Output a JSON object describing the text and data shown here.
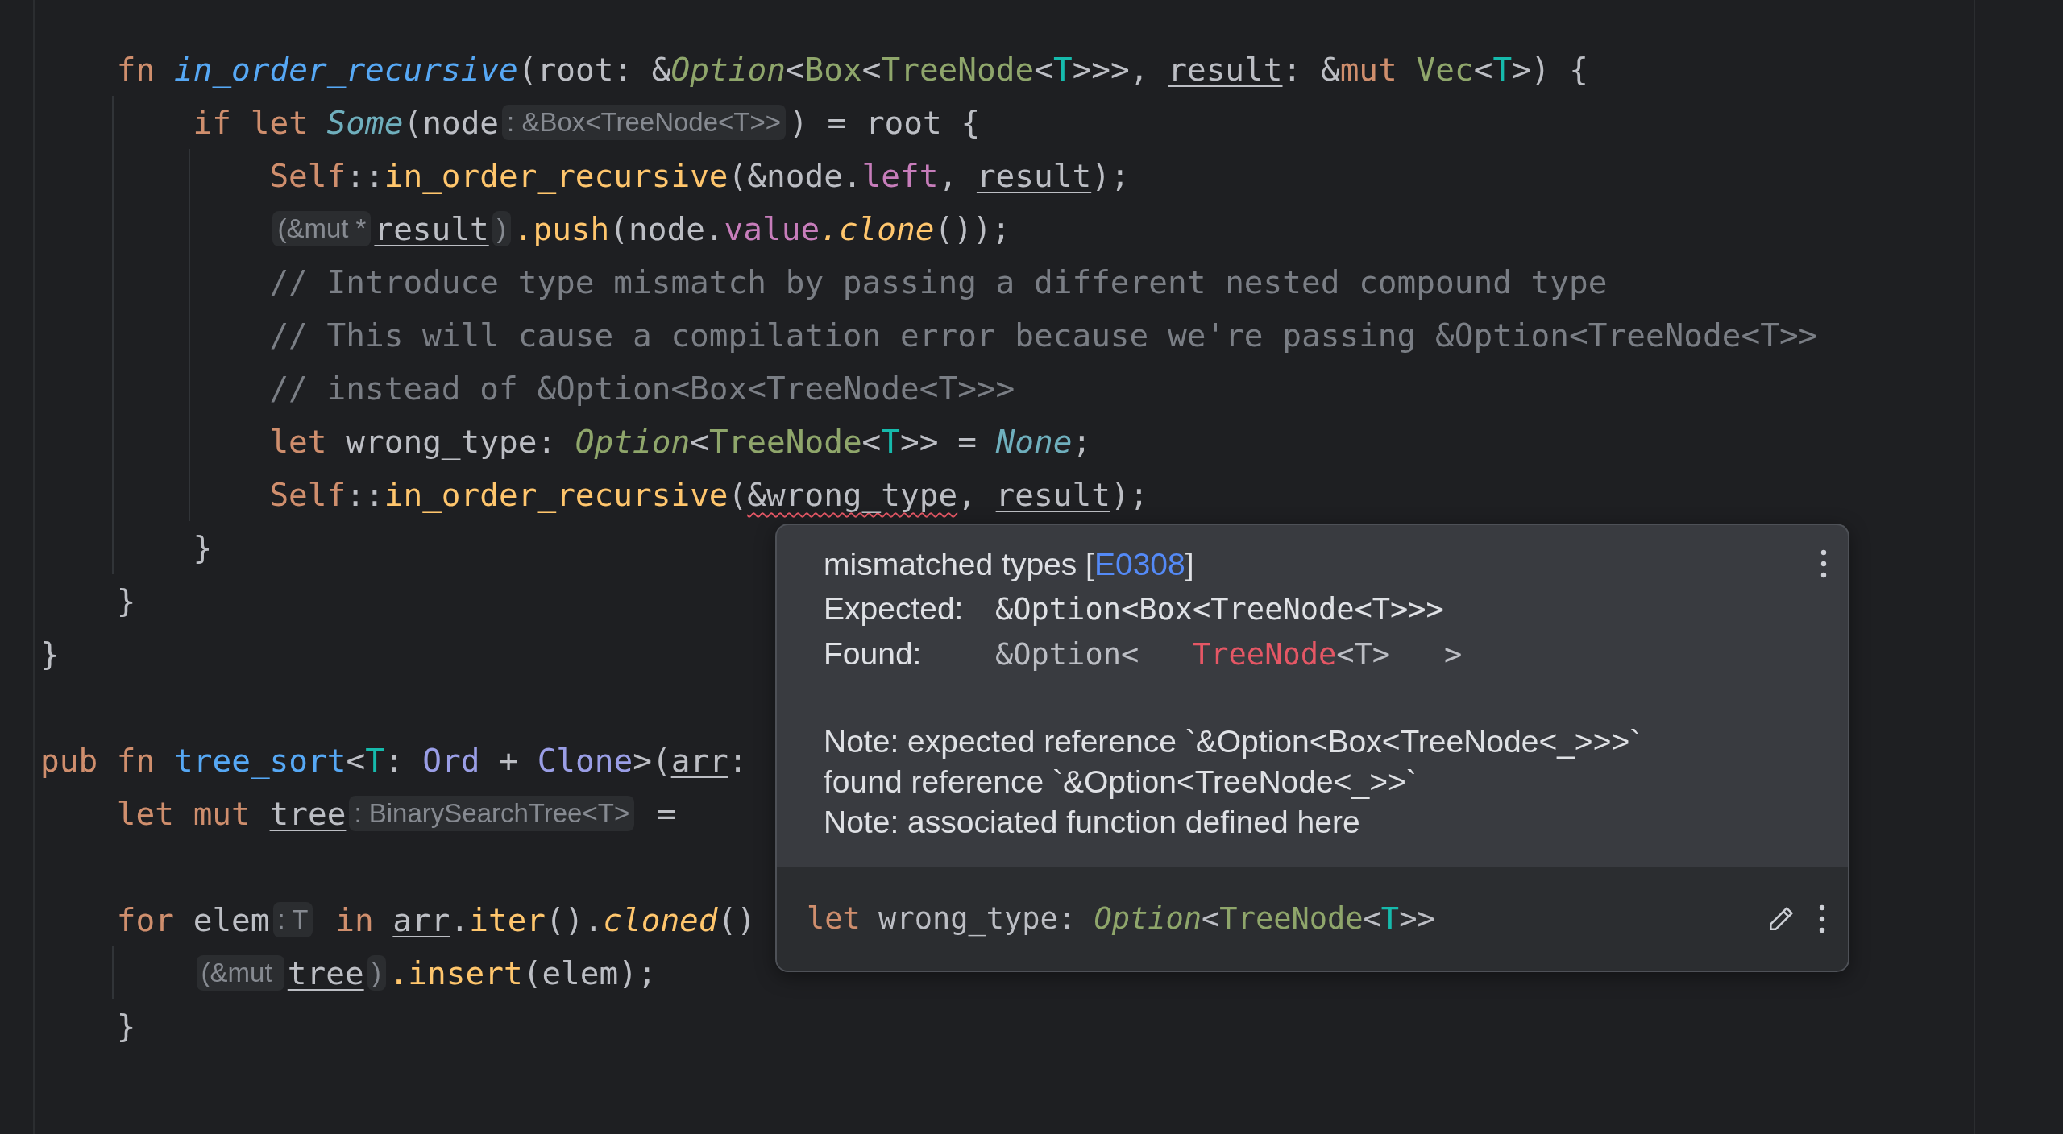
{
  "editor": {
    "lines": [
      {
        "kind": "code",
        "tokens": [
          {
            "text": "    fn ",
            "kind": "kw"
          },
          {
            "text": "in_order_recursive",
            "kind": "fn_decl_italic"
          },
          {
            "text": "(root: &",
            "kind": "plain"
          },
          {
            "text": "Option",
            "kind": "type_italic"
          },
          {
            "text": "<",
            "kind": "plain"
          },
          {
            "text": "Box",
            "kind": "type"
          },
          {
            "text": "<",
            "kind": "plain"
          },
          {
            "text": "TreeNode",
            "kind": "type"
          },
          {
            "text": "<",
            "kind": "plain"
          },
          {
            "text": "T",
            "kind": "generic"
          },
          {
            "text": ">>>, ",
            "kind": "plain"
          },
          {
            "text": "result",
            "kind": "underlined"
          },
          {
            "text": ": &",
            "kind": "plain"
          },
          {
            "text": "mut ",
            "kind": "kw"
          },
          {
            "text": "Vec",
            "kind": "type"
          },
          {
            "text": "<",
            "kind": "plain"
          },
          {
            "text": "T",
            "kind": "generic"
          },
          {
            "text": ">) {",
            "kind": "plain"
          }
        ]
      },
      {
        "kind": "code",
        "tokens": [
          {
            "text": "        if let ",
            "kind": "kw"
          },
          {
            "text": "Some",
            "kind": "variant_italic"
          },
          {
            "text": "(node",
            "kind": "plain"
          },
          {
            "text": ": &Box<TreeNode<T>>",
            "kind": "hint"
          },
          {
            "text": ") = root {",
            "kind": "plain"
          }
        ]
      },
      {
        "kind": "code",
        "tokens": [
          {
            "text": "            Self",
            "kind": "kw"
          },
          {
            "text": "::",
            "kind": "plain"
          },
          {
            "text": "in_order_recursive",
            "kind": "method"
          },
          {
            "text": "(&node.",
            "kind": "plain"
          },
          {
            "text": "left",
            "kind": "field"
          },
          {
            "text": ", ",
            "kind": "plain"
          },
          {
            "text": "result",
            "kind": "underlined"
          },
          {
            "text": ");",
            "kind": "plain"
          }
        ]
      },
      {
        "kind": "code",
        "tokens": [
          {
            "text": "            (&mut *",
            "kind": "hint"
          },
          {
            "text": "result",
            "kind": "underlined"
          },
          {
            "text": ")",
            "kind": "hint"
          },
          {
            "text": ".push",
            "kind": "method"
          },
          {
            "text": "(node.",
            "kind": "plain"
          },
          {
            "text": "value",
            "kind": "field"
          },
          {
            "text": ".clone",
            "kind": "method_italic"
          },
          {
            "text": "());",
            "kind": "plain"
          }
        ]
      },
      {
        "kind": "code",
        "tokens": [
          {
            "text": "            // Introduce type mismatch by passing a different nested compound type",
            "kind": "comment"
          }
        ]
      },
      {
        "kind": "code",
        "tokens": [
          {
            "text": "            // This will cause a compilation error because we're passing &Option<TreeNode<T>>",
            "kind": "comment"
          }
        ]
      },
      {
        "kind": "code",
        "tokens": [
          {
            "text": "            // instead of &Option<Box<TreeNode<T>>>",
            "kind": "comment"
          }
        ]
      },
      {
        "kind": "code",
        "tokens": [
          {
            "text": "            let ",
            "kind": "kw"
          },
          {
            "text": "wrong_type: ",
            "kind": "plain"
          },
          {
            "text": "Option",
            "kind": "type_italic"
          },
          {
            "text": "<",
            "kind": "plain"
          },
          {
            "text": "TreeNode",
            "kind": "type"
          },
          {
            "text": "<",
            "kind": "plain"
          },
          {
            "text": "T",
            "kind": "generic"
          },
          {
            "text": ">> = ",
            "kind": "plain"
          },
          {
            "text": "None",
            "kind": "variant_italic"
          },
          {
            "text": ";",
            "kind": "plain"
          }
        ]
      },
      {
        "kind": "code",
        "tokens": [
          {
            "text": "            Self",
            "kind": "kw"
          },
          {
            "text": "::",
            "kind": "plain"
          },
          {
            "text": "in_order_recursive",
            "kind": "method"
          },
          {
            "text": "(",
            "kind": "plain"
          },
          {
            "text": "&wrong_type",
            "kind": "error"
          },
          {
            "text": ", ",
            "kind": "plain"
          },
          {
            "text": "result",
            "kind": "underlined"
          },
          {
            "text": ");",
            "kind": "plain"
          }
        ]
      },
      {
        "kind": "code",
        "tokens": [
          {
            "text": "        }",
            "kind": "plain"
          }
        ]
      },
      {
        "kind": "code",
        "tokens": [
          {
            "text": "    }",
            "kind": "plain"
          }
        ]
      },
      {
        "kind": "code",
        "tokens": [
          {
            "text": "}",
            "kind": "plain"
          }
        ]
      },
      {
        "kind": "blank"
      },
      {
        "kind": "code",
        "tokens": [
          {
            "text": "pub fn ",
            "kind": "kw"
          },
          {
            "text": "tree_sort",
            "kind": "fn_decl"
          },
          {
            "text": "<",
            "kind": "plain"
          },
          {
            "text": "T",
            "kind": "generic"
          },
          {
            "text": ": ",
            "kind": "plain"
          },
          {
            "text": "Ord",
            "kind": "trait"
          },
          {
            "text": " + ",
            "kind": "plain"
          },
          {
            "text": "Clone",
            "kind": "trait"
          },
          {
            "text": ">(",
            "kind": "plain"
          },
          {
            "text": "arr",
            "kind": "underlined"
          },
          {
            "text": ":",
            "kind": "plain"
          }
        ]
      },
      {
        "kind": "code",
        "tokens": [
          {
            "text": "    let mut ",
            "kind": "kw"
          },
          {
            "text": "tree",
            "kind": "underlined"
          },
          {
            "text": ": BinarySearchTree<T>",
            "kind": "hint"
          },
          {
            "text": " =",
            "kind": "plain"
          }
        ]
      },
      {
        "kind": "blank"
      },
      {
        "kind": "code",
        "tokens": [
          {
            "text": "    for ",
            "kind": "kw"
          },
          {
            "text": "elem",
            "kind": "plain"
          },
          {
            "text": ": T",
            "kind": "hint"
          },
          {
            "text": " in ",
            "kind": "kw"
          },
          {
            "text": "arr",
            "kind": "underlined"
          },
          {
            "text": ".",
            "kind": "plain"
          },
          {
            "text": "iter",
            "kind": "method"
          },
          {
            "text": "().",
            "kind": "plain"
          },
          {
            "text": "cloned",
            "kind": "method_italic"
          },
          {
            "text": "()",
            "kind": "plain"
          }
        ]
      },
      {
        "kind": "code",
        "tokens": [
          {
            "text": "        (&mut ",
            "kind": "hint"
          },
          {
            "text": "tree",
            "kind": "underlined"
          },
          {
            "text": ")",
            "kind": "hint"
          },
          {
            "text": ".insert",
            "kind": "method"
          },
          {
            "text": "(elem);",
            "kind": "plain"
          }
        ]
      },
      {
        "kind": "code",
        "tokens": [
          {
            "text": "    }",
            "kind": "plain"
          }
        ]
      }
    ]
  },
  "error_popup": {
    "title": "mismatched types [",
    "error_code": "E0308",
    "title_close": "]",
    "expected": {
      "label": "Expected:",
      "value": "&Option<Box<TreeNode<T>>>"
    },
    "found": {
      "label": "Found:",
      "parts": [
        {
          "text": "&Option<   ",
          "kind": "plain"
        },
        {
          "text": "TreeNode",
          "kind": "mismatch"
        },
        {
          "text": "<T>   >",
          "kind": "plain"
        }
      ]
    },
    "notes": [
      "Note: expected reference `&Option<Box<TreeNode<_>>>`",
      "found reference `&Option<TreeNode<_>>`",
      "Note: associated function defined here"
    ],
    "declaration": [
      {
        "text": "let ",
        "kind": "kw"
      },
      {
        "text": "wrong_type: ",
        "kind": "plain"
      },
      {
        "text": "Option",
        "kind": "type_italic"
      },
      {
        "text": "<",
        "kind": "plain"
      },
      {
        "text": "TreeNode",
        "kind": "type"
      },
      {
        "text": "<",
        "kind": "plain"
      },
      {
        "text": "T",
        "kind": "generic"
      },
      {
        "text": ">>",
        "kind": "plain"
      }
    ]
  }
}
